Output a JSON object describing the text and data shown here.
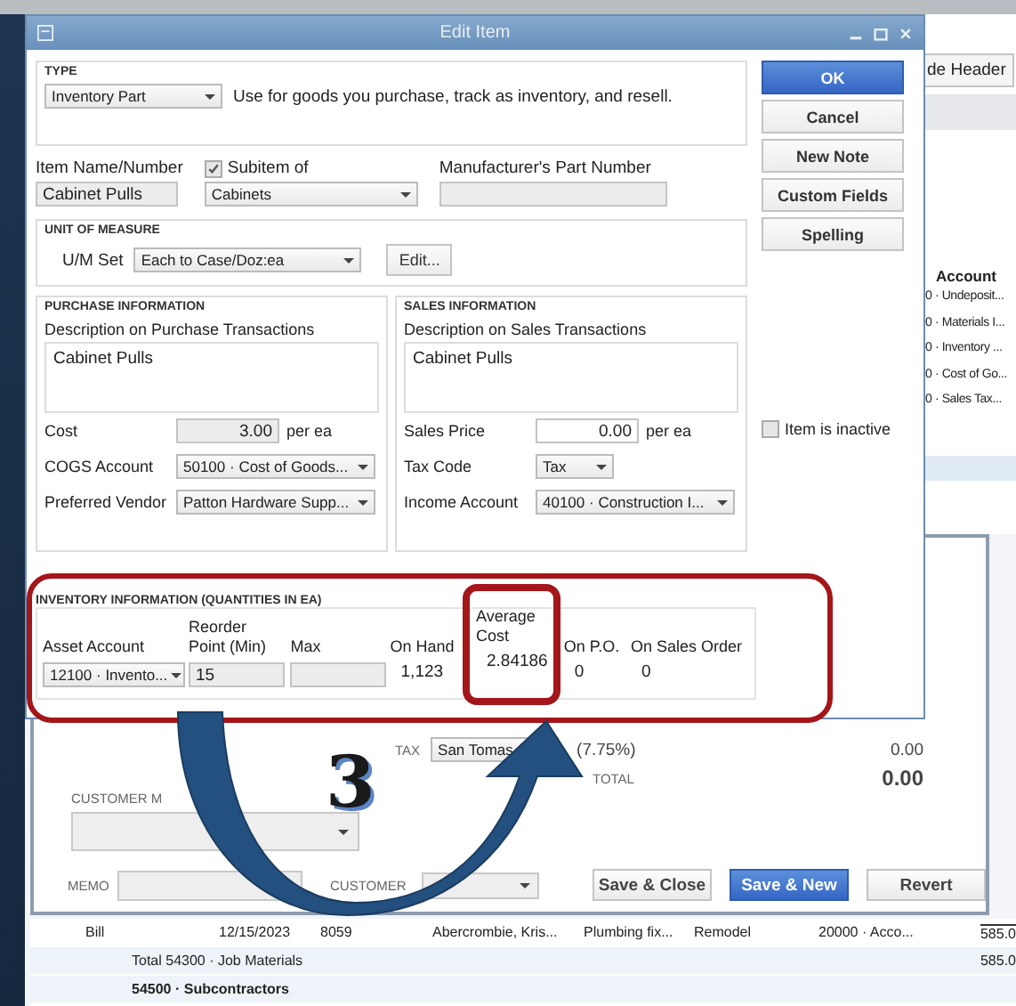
{
  "background_window": {
    "header_button": "de Header",
    "account_heading": "Account",
    "account_rows": [
      "0 · Undeposit...",
      "0 · Materials I...",
      "0 · Inventory ...",
      "0 · Cost of Go...",
      "0 · Sales Tax..."
    ]
  },
  "invoice": {
    "tax_label": "TAX",
    "tax_item": "San Tomas",
    "tax_rate": "(7.75%)",
    "tax_amount": "0.00",
    "total_label": "TOTAL",
    "total": "0.00",
    "customer_message_label": "CUSTOMER M",
    "memo_label": "MEMO",
    "customer_tax_label": "CUSTOMER",
    "buttons": [
      {
        "label": "Save & Close",
        "primary": false
      },
      {
        "label": "Save & New",
        "primary": true
      },
      {
        "label": "Revert",
        "primary": false
      }
    ]
  },
  "report": {
    "detail_row": {
      "type": "Bill",
      "date": "12/15/2023",
      "num": "8059",
      "name": "Abercrombie, Kris...",
      "memo": "Plumbing fix...",
      "class": "Remodel",
      "split": "20000 · Acco...",
      "amount": "585.0"
    },
    "total_line": {
      "label": "Total 54300 · Job Materials",
      "amount": "585.0"
    },
    "account_heading": "54500 · Subcontractors"
  },
  "dialog": {
    "title": "Edit Item",
    "type_section": {
      "heading": "TYPE",
      "type": "Inventory Part",
      "description": "Use for goods you purchase, track as inventory, and resell."
    },
    "item_name": {
      "label": "Item Name/Number",
      "value": "Cabinet Pulls"
    },
    "subitem": {
      "label": "Subitem of",
      "checked": true,
      "value": "Cabinets"
    },
    "manufacturer_part": {
      "label": "Manufacturer's Part Number"
    },
    "unit_of_measure": {
      "heading": "UNIT OF MEASURE",
      "label": "U/M Set",
      "value": "Each to Case/Doz:ea",
      "button": "Edit..."
    },
    "purchase": {
      "heading": "PURCHASE INFORMATION",
      "description_label": "Description on Purchase Transactions",
      "description": "Cabinet Pulls",
      "fields": [
        {
          "label": "Cost",
          "kind": "shaded",
          "value": "3.00",
          "unit": "per ea"
        },
        {
          "label": "COGS Account",
          "kind": "dropdown",
          "value": "50100 · Cost of Goods..."
        },
        {
          "label": "Preferred Vendor",
          "kind": "dropdown",
          "value": "Patton Hardware Supp..."
        }
      ]
    },
    "sales": {
      "heading": "SALES INFORMATION",
      "description_label": "Description on Sales Transactions",
      "description": "Cabinet Pulls",
      "fields": [
        {
          "label": "Sales Price",
          "kind": "amount",
          "value": "0.00",
          "unit": "per ea"
        },
        {
          "label": "Tax Code",
          "kind": "short-dropdown",
          "value": "Tax"
        },
        {
          "label": "Income Account",
          "kind": "dropdown",
          "value": "40100 · Construction I..."
        }
      ]
    },
    "buttons": [
      {
        "label": "OK",
        "primary": true
      },
      {
        "label": "Cancel",
        "primary": false
      },
      {
        "label": "New Note",
        "primary": false
      },
      {
        "label": "Custom Fields",
        "primary": false
      },
      {
        "label": "Spelling",
        "primary": false
      }
    ],
    "inactive": {
      "label": "Item is inactive",
      "checked": false
    },
    "inventory": {
      "heading": "INVENTORY INFORMATION (QUANTITIES IN EA)",
      "columns": [
        {
          "label": "Asset Account",
          "kind": "dropdown",
          "value": "12100 · Invento...",
          "highlighted": false
        },
        {
          "label": "Reorder Point (Min)",
          "kind": "input",
          "value": "15",
          "highlighted": false
        },
        {
          "label": "Max",
          "kind": "input",
          "highlighted": false
        },
        {
          "label": "On Hand",
          "kind": "text",
          "value": "1,123",
          "highlighted": false
        },
        {
          "label": "Average Cost",
          "kind": "text",
          "value": "2.84186",
          "highlighted": true
        },
        {
          "label": "On P.O.",
          "kind": "text",
          "value": "0",
          "highlighted": false
        },
        {
          "label": "On Sales Order",
          "kind": "text",
          "value": "0",
          "highlighted": false
        }
      ]
    }
  },
  "annotation": {
    "step": "3"
  }
}
